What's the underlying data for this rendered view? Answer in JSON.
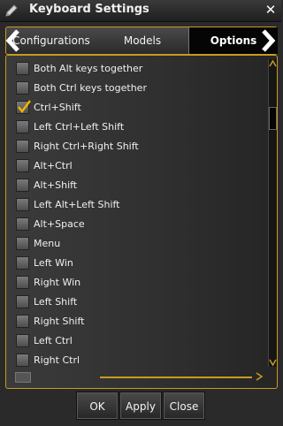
{
  "window": {
    "title": "Keyboard Settings",
    "close_glyph": "✕"
  },
  "tabs": [
    {
      "label": "Configurations"
    },
    {
      "label": "Models"
    },
    {
      "label": "Options",
      "active": true
    }
  ],
  "options": [
    {
      "label": "Both Alt keys together",
      "checked": false
    },
    {
      "label": "Both Ctrl keys together",
      "checked": false
    },
    {
      "label": "Ctrl+Shift",
      "checked": true
    },
    {
      "label": "Left Ctrl+Left Shift",
      "checked": false
    },
    {
      "label": "Right Ctrl+Right Shift",
      "checked": false
    },
    {
      "label": "Alt+Ctrl",
      "checked": false
    },
    {
      "label": "Alt+Shift",
      "checked": false
    },
    {
      "label": "Left Alt+Left Shift",
      "checked": false
    },
    {
      "label": "Alt+Space",
      "checked": false
    },
    {
      "label": "Menu",
      "checked": false
    },
    {
      "label": "Left Win",
      "checked": false
    },
    {
      "label": "Right Win",
      "checked": false
    },
    {
      "label": "Left Shift",
      "checked": false
    },
    {
      "label": "Right Shift",
      "checked": false
    },
    {
      "label": "Left Ctrl",
      "checked": false
    },
    {
      "label": "Right Ctrl",
      "checked": false
    }
  ],
  "buttons": {
    "ok": "OK",
    "apply": "Apply",
    "close": "Close"
  },
  "colors": {
    "accent": "#c99a20",
    "background": "#2a2a2a"
  },
  "icons": {
    "app": "pencil-icon",
    "close": "close-icon",
    "prev": "chevron-left-icon",
    "next": "chevron-right-icon"
  }
}
